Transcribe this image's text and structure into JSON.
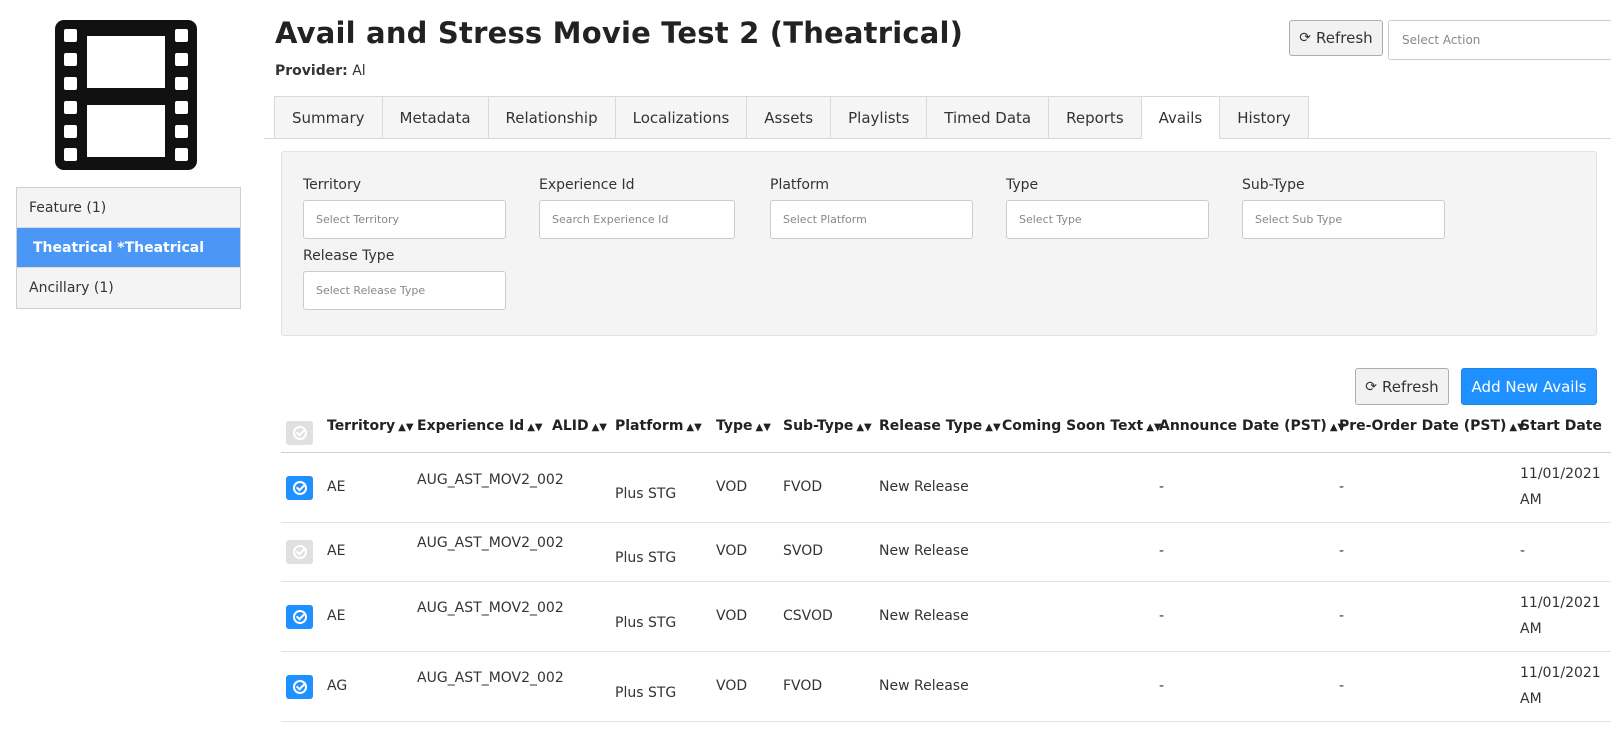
{
  "header": {
    "title": "Avail and Stress Movie Test 2 (Theatrical)",
    "provider_label": "Provider:",
    "provider_value": "Al",
    "refresh_label": "Refresh",
    "action_placeholder": "Select Action"
  },
  "sidebar": {
    "items": [
      {
        "label": "Feature (1)"
      },
      {
        "label": "Theatrical *Theatrical"
      },
      {
        "label": "Ancillary (1)"
      }
    ]
  },
  "tabs": [
    {
      "label": "Summary"
    },
    {
      "label": "Metadata"
    },
    {
      "label": "Relationship"
    },
    {
      "label": "Localizations"
    },
    {
      "label": "Assets"
    },
    {
      "label": "Playlists"
    },
    {
      "label": "Timed Data"
    },
    {
      "label": "Reports"
    },
    {
      "label": "Avails"
    },
    {
      "label": "History"
    }
  ],
  "filters": {
    "territory": {
      "label": "Territory",
      "placeholder": "Select Territory"
    },
    "experience_id": {
      "label": "Experience Id",
      "placeholder": "Search Experience Id"
    },
    "platform": {
      "label": "Platform",
      "placeholder": "Select Platform"
    },
    "type": {
      "label": "Type",
      "placeholder": "Select Type"
    },
    "sub_type": {
      "label": "Sub-Type",
      "placeholder": "Select Sub Type"
    },
    "release_type": {
      "label": "Release Type",
      "placeholder": "Select Release Type"
    }
  },
  "table_toolbar": {
    "refresh_label": "Refresh",
    "add_label": "Add New Avails"
  },
  "table": {
    "columns": [
      "Territory",
      "Experience Id",
      "ALID",
      "Platform",
      "Type",
      "Sub-Type",
      "Release Type",
      "Coming Soon Text",
      "Announce Date (PST)",
      "Pre-Order Date (PST)",
      "Start Date"
    ],
    "rows": [
      {
        "checked": true,
        "territory": "AE",
        "experience_id": "AUG_AST_MOV2_002",
        "alid": "",
        "platform": "Plus STG",
        "type": "VOD",
        "sub_type": "FVOD",
        "release_type": "New Release",
        "coming_soon": "",
        "announce": "-",
        "preorder": "-",
        "start_date": "11/01/2021",
        "start_time": "AM"
      },
      {
        "checked": false,
        "territory": "AE",
        "experience_id": "AUG_AST_MOV2_002",
        "alid": "",
        "platform": "Plus STG",
        "type": "VOD",
        "sub_type": "SVOD",
        "release_type": "New Release",
        "coming_soon": "",
        "announce": "-",
        "preorder": "-",
        "start_date": "-",
        "start_time": ""
      },
      {
        "checked": true,
        "territory": "AE",
        "experience_id": "AUG_AST_MOV2_002",
        "alid": "",
        "platform": "Plus STG",
        "type": "VOD",
        "sub_type": "CSVOD",
        "release_type": "New Release",
        "coming_soon": "",
        "announce": "-",
        "preorder": "-",
        "start_date": "11/01/2021",
        "start_time": "AM"
      },
      {
        "checked": true,
        "territory": "AG",
        "experience_id": "AUG_AST_MOV2_002",
        "alid": "",
        "platform": "Plus STG",
        "type": "VOD",
        "sub_type": "FVOD",
        "release_type": "New Release",
        "coming_soon": "",
        "announce": "-",
        "preorder": "-",
        "start_date": "11/01/2021",
        "start_time": "AM"
      }
    ]
  }
}
